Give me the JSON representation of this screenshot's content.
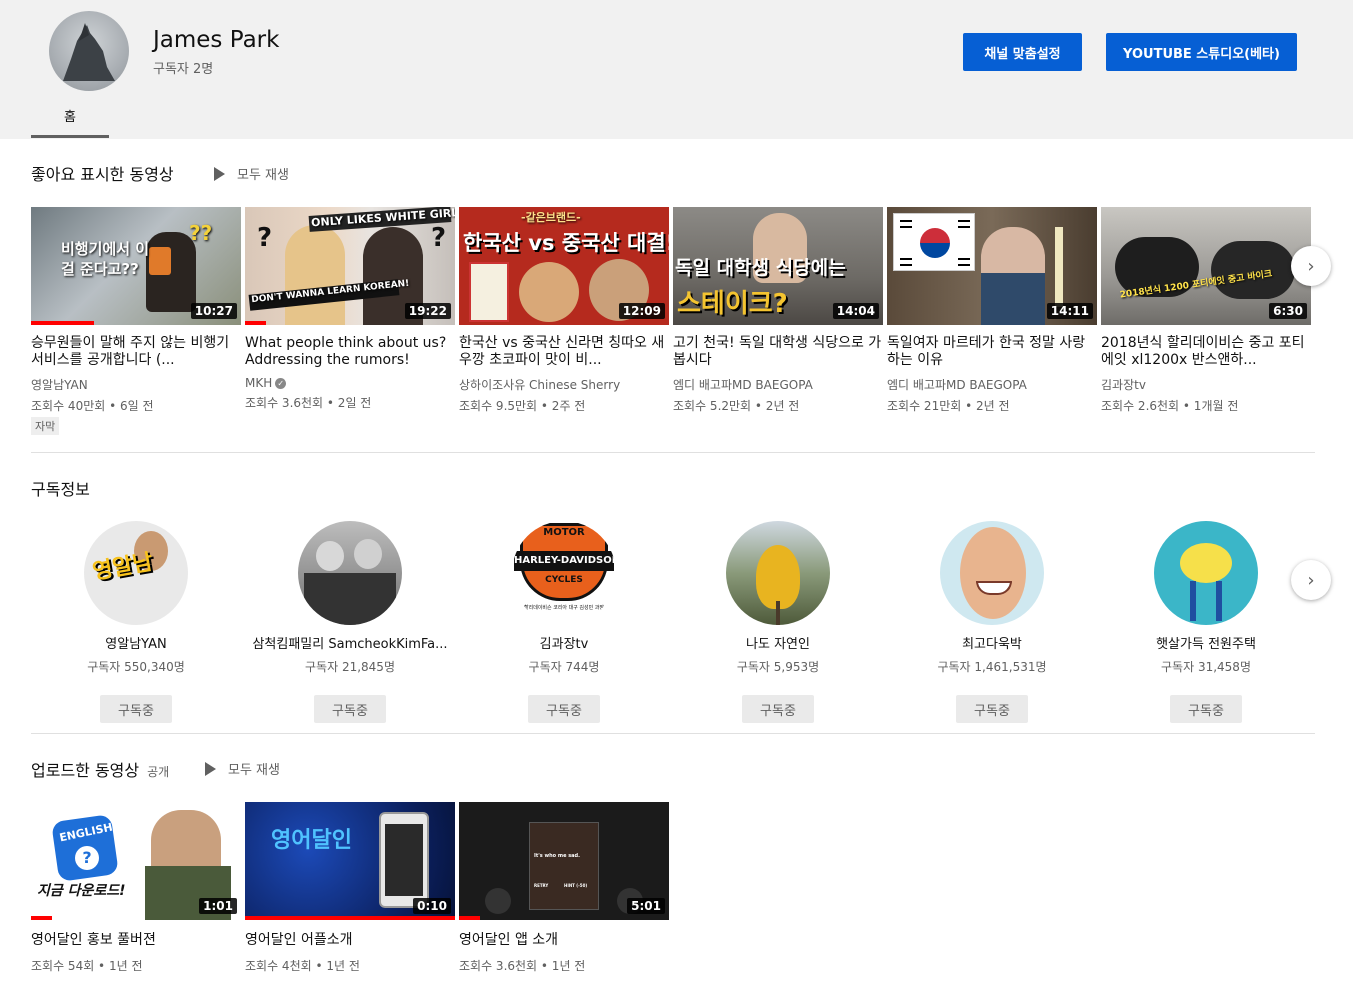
{
  "channel": {
    "name": "James Park",
    "subscribers": "구독자 2명",
    "customize_label": "채널 맞춤설정",
    "studio_label": "YOUTUBE 스튜디오(베타)",
    "tab_home": "홈"
  },
  "liked": {
    "title": "좋아요 표시한 동영상",
    "play_all": "모두 재생",
    "videos": [
      {
        "title": "승무원들이 말해 주지 않는 비행기 서비스를 공개합니다 (...",
        "channel": "영알남YAN",
        "meta": "조회수 40만회 • 6일 전",
        "duration": "10:27",
        "badge": "자막",
        "thumb_text": "비행기에서 이걸 준다고??",
        "progress": 0.3
      },
      {
        "title": "What people think about us? Addressing the rumors!",
        "channel": "MKH",
        "meta": "조회수 3.6천회 • 2일 전",
        "duration": "19:22",
        "thumb_text": "ONLY LIKES WHITE GIRLS",
        "thumb_text2": "DON'T WANNA LEARN KOREAN!",
        "progress": 0.1
      },
      {
        "title": "한국산 vs 중국산 신라면 칭따오 새우깡 초코파이 맛이 비...",
        "channel": "상하이조사유 Chinese Sherry",
        "meta": "조회수 9.5만회 • 2주 전",
        "duration": "12:09",
        "thumb_text": "한국산 vs 중국산 대결!",
        "thumb_text2": "-같은브랜드-",
        "progress": 0.0
      },
      {
        "title": "고기 천국! 독일 대학생 식당으로 가봅시다",
        "channel": "엠디 배고파MD BAEGOPA",
        "meta": "조회수 5.2만회 • 2년 전",
        "duration": "14:04",
        "thumb_text": "독일 대학생 식당에는",
        "thumb_text2": "스테이크?",
        "progress": 0.0
      },
      {
        "title": "독일여자 마르테가 한국 정말 사랑하는 이유",
        "channel": "엠디 배고파MD BAEGOPA",
        "meta": "조회수 21만회 • 2년 전",
        "duration": "14:11",
        "progress": 0.0
      },
      {
        "title": "2018년식 할리데이비슨 중고 포티에잇 xl1200x 반스앤하...",
        "channel": "김과장tv",
        "meta": "조회수 2.6천회 • 1개월 전",
        "duration": "6:30",
        "thumb_text": "2018년식 1200 포티에잇 중고 바이크",
        "progress": 0.0
      }
    ]
  },
  "subscriptions": {
    "title": "구독정보",
    "button_label": "구독중",
    "channels": [
      {
        "name": "영알남YAN",
        "count": "구독자 550,340명",
        "pic_text": "영알남"
      },
      {
        "name": "삼척킴패밀리 SamcheokKimFa...",
        "count": "구독자 21,845명"
      },
      {
        "name": "김과장tv",
        "count": "구독자 744명",
        "pic_text": "HARLEY-DAVIDSON",
        "pic_text2": "MOTOR",
        "pic_text3": "CYCLES",
        "pic_text4": "할리데이비슨 코리아 대구 김성민 과장"
      },
      {
        "name": "나도 자연인",
        "count": "구독자 5,953명"
      },
      {
        "name": "최고다욱박",
        "count": "구독자 1,461,531명"
      },
      {
        "name": "햇살가득 전원주택",
        "count": "구독자 31,458명"
      }
    ]
  },
  "uploads": {
    "title": "업로드한 동영상",
    "visibility": "공개",
    "play_all": "모두 재생",
    "videos": [
      {
        "title": "영어달인 홍보 풀버젼",
        "meta": "조회수 54회 • 1년 전",
        "duration": "1:01",
        "thumb_text": "ENGLISH",
        "thumb_text2": "지금 다운로드!",
        "progress": 0.1
      },
      {
        "title": "영어달인 어플소개",
        "meta": "조회수 4천회 • 1년 전",
        "duration": "0:10",
        "thumb_text": "영어달인",
        "progress": 1.0
      },
      {
        "title": "영어달인 앱 소개",
        "meta": "조회수 3.6천회 • 1년 전",
        "duration": "5:01",
        "thumb_text": "It's who me sad.",
        "thumb_text2": "RETRY",
        "thumb_text3": "HINT (-50)",
        "progress": 0.1
      }
    ]
  },
  "colors": {
    "accent": "#065fd4",
    "progress": "#ff0000",
    "header_bg": "#f1f1f1"
  },
  "icons": {
    "play": "play-icon",
    "next": "chevron-right-icon",
    "verified": "verified-check-icon"
  }
}
